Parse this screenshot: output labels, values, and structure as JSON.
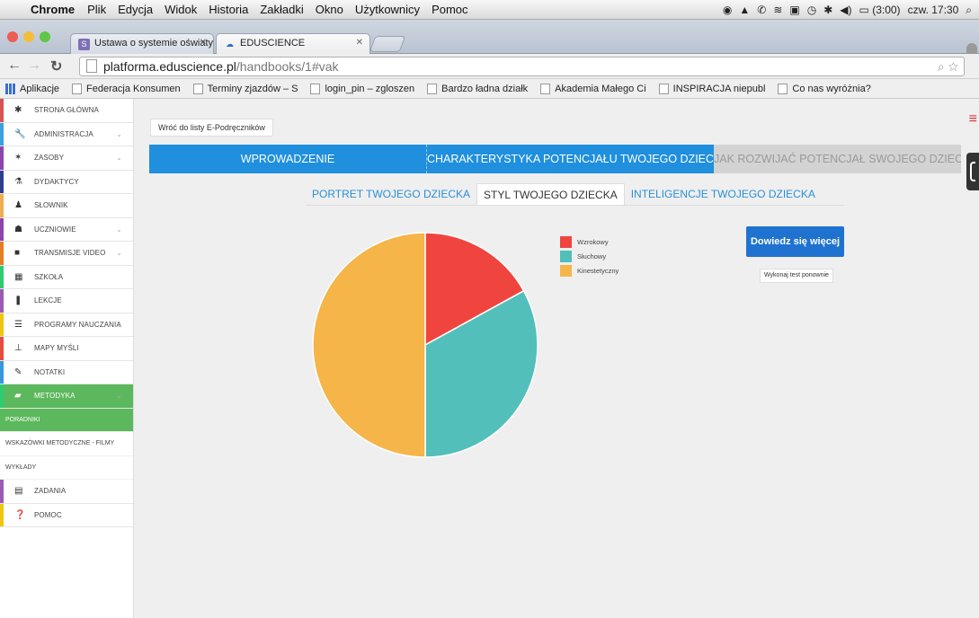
{
  "macos_menu": {
    "app": "Chrome",
    "items": [
      "Plik",
      "Edycja",
      "Widok",
      "Historia",
      "Zakładki",
      "Okno",
      "Użytkownicy",
      "Pomoc"
    ],
    "battery": "(3:00)",
    "clock": "czw. 17:30"
  },
  "browser": {
    "tabs": [
      {
        "label": "Ustawa o systemie oświaty",
        "active": false
      },
      {
        "label": "EDUSCIENCE",
        "active": true
      }
    ],
    "url_host": "platforma.eduscience.pl",
    "url_path": "/handbooks/1#vak",
    "bookmarks": [
      "Aplikacje",
      "Federacja Konsumen",
      "Terminy zjazdów – S",
      "login_pin – zgloszen",
      "Bardzo ładna działk",
      "Akademia Małego Ci",
      "INSPIRACJA niepubl",
      "Co nas wyróżnia?"
    ]
  },
  "sidebar": {
    "items": [
      {
        "label": "STRONA GŁÓWNA",
        "icon": "home-icon",
        "glyph": "✱",
        "color": "#d9534f",
        "chevron": false
      },
      {
        "label": "ADMINISTRACJA",
        "icon": "wrench-icon",
        "glyph": "🔧",
        "color": "#3aa0e0",
        "chevron": true
      },
      {
        "label": "ZASOBY",
        "icon": "magic-wand-icon",
        "glyph": "✶",
        "color": "#8e44ad",
        "chevron": true
      },
      {
        "label": "DYDAKTYCY",
        "icon": "flask-icon",
        "glyph": "⚗",
        "color": "#2c3e8f",
        "chevron": false
      },
      {
        "label": "SŁOWNIK",
        "icon": "person-icon",
        "glyph": "♟",
        "color": "#f0ad4e",
        "chevron": false
      },
      {
        "label": "UCZNIOWIE",
        "icon": "group-icon",
        "glyph": "☗",
        "color": "#8e44ad",
        "chevron": true
      },
      {
        "label": "TRANSMISJE VIDEO",
        "icon": "video-icon",
        "glyph": "■",
        "color": "#e67e22",
        "chevron": true
      },
      {
        "label": "SZKOŁA",
        "icon": "building-icon",
        "glyph": "▦",
        "color": "#2ecc71",
        "chevron": false
      },
      {
        "label": "LEKCJE",
        "icon": "book-icon",
        "glyph": "❚",
        "color": "#9b59b6",
        "chevron": false
      },
      {
        "label": "PROGRAMY NAUCZANIA",
        "icon": "list-icon",
        "glyph": "☰",
        "color": "#f1c40f",
        "chevron": true
      },
      {
        "label": "MAPY MYŚLI",
        "icon": "sitemap-icon",
        "glyph": "⊥",
        "color": "#e74c3c",
        "chevron": false
      },
      {
        "label": "NOTATKI",
        "icon": "pencil-icon",
        "glyph": "✎",
        "color": "#3498db",
        "chevron": false
      },
      {
        "label": "METODYKA",
        "icon": "book-open-icon",
        "glyph": "▰",
        "color": "#2ecc71",
        "chevron": true,
        "active": true
      }
    ],
    "subitems": [
      {
        "label": "PORADNIKI",
        "active": true
      },
      {
        "label": "WSKAZÓWKI METODYCZNE - FILMY",
        "active": false
      },
      {
        "label": "WYKŁADY",
        "active": false
      }
    ],
    "bottom_items": [
      {
        "label": "ZADANIA",
        "icon": "calendar-icon",
        "glyph": "▤",
        "color": "#9b59b6"
      },
      {
        "label": "POMOC",
        "icon": "question-icon",
        "glyph": "❓",
        "color": "#f1c40f"
      }
    ]
  },
  "main": {
    "back_label": "Wróć do listy E-Podręczników",
    "top_tabs": [
      {
        "label": "WPROWADZENIE",
        "style": "blue"
      },
      {
        "label": "CHARAKTERYSTYKA POTENCJAŁU TWOJEGO DZIECKA",
        "style": "blue"
      },
      {
        "label": "JAK ROZWIJAĆ POTENCJAŁ SWOJEGO DZIECKA?",
        "style": "gray"
      }
    ],
    "sub_tabs": [
      {
        "label": "PORTRET TWOJEGO DZIECKA",
        "active": false
      },
      {
        "label": "STYL TWOJEGO DZIECKA",
        "active": true
      },
      {
        "label": "INTELIGENCJE TWOJEGO DZIECKA",
        "active": false
      }
    ],
    "learn_more": "Dowiedz się więcej",
    "retry": "Wykonaj test ponownie"
  },
  "chart_data": {
    "type": "pie",
    "labels": [
      "Wzrokowy",
      "Słuchowy",
      "Kinestetyczny"
    ],
    "values": [
      17,
      33,
      50
    ],
    "colors": [
      "#f0453f",
      "#52bfbb",
      "#f5b549"
    ],
    "legend": "top-right"
  }
}
